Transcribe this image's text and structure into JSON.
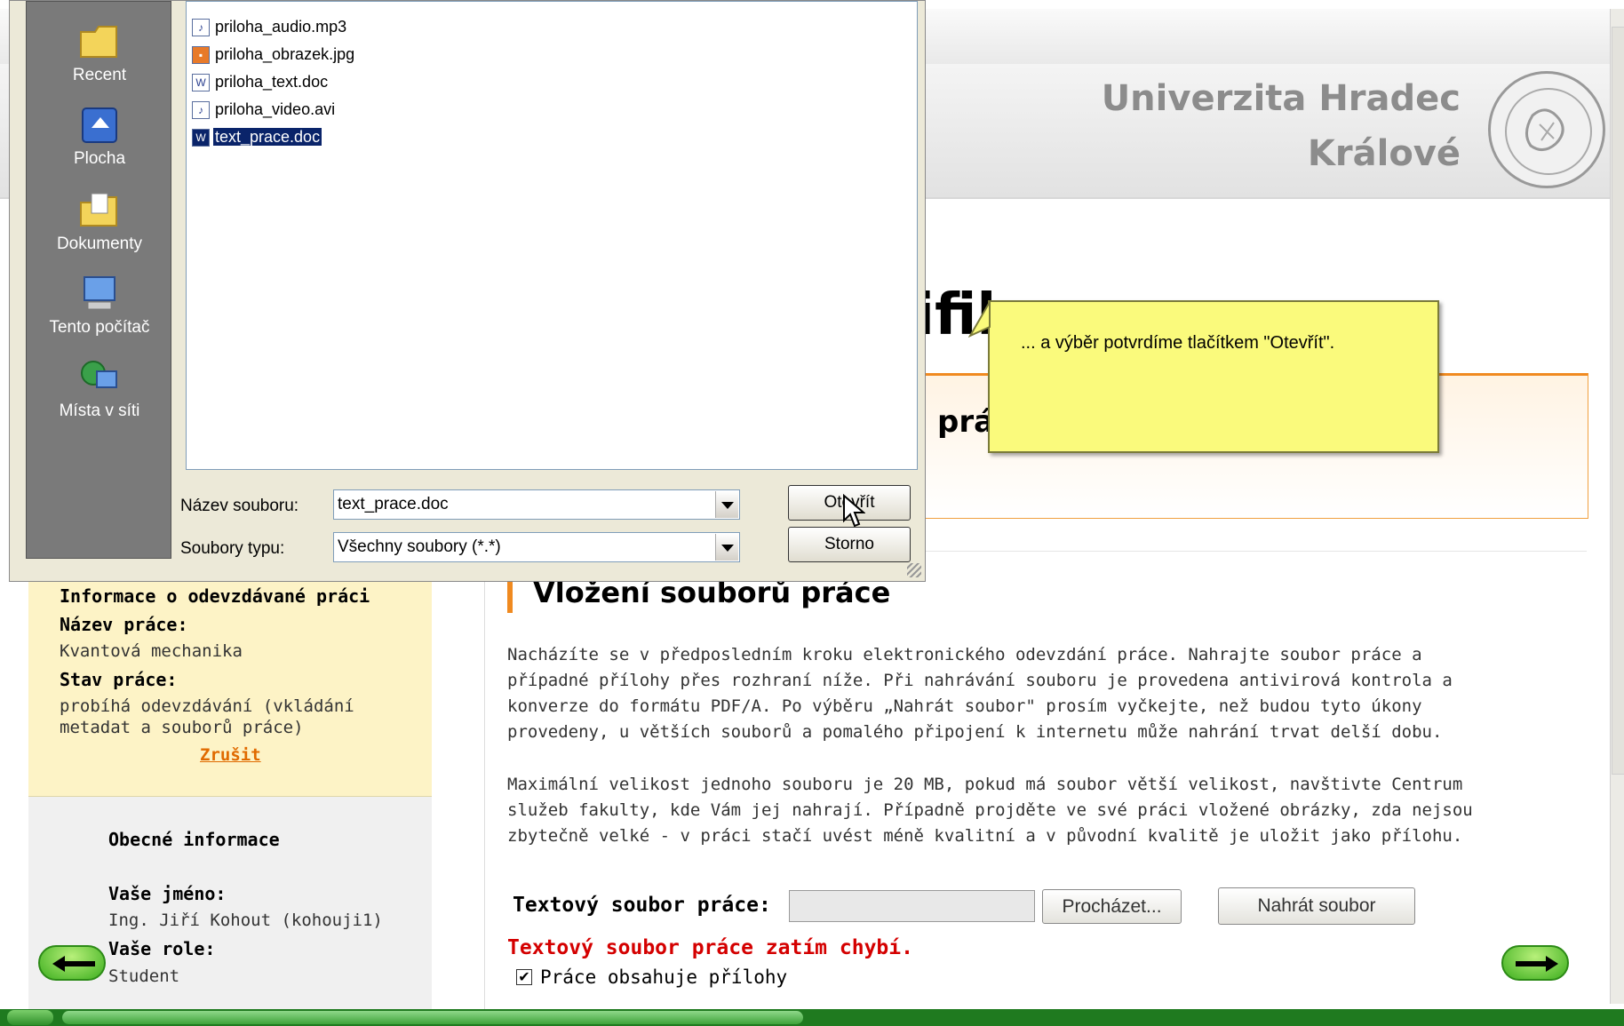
{
  "university": {
    "line1": "Univerzita Hradec",
    "line2": "Králové"
  },
  "page_heading_fragment": "ifik",
  "orange_box_fragment": "prá",
  "sidebar": {
    "info_title": "Informace o odevzdávané práci",
    "work_name_label": "Název práce:",
    "work_name_value": "Kvantová mechanika",
    "work_state_label": "Stav práce:",
    "work_state_value_line1": "probíhá odevzdávání (vkládání",
    "work_state_value_line2": "metadat a souborů práce)",
    "cancel_link": "Zrušit",
    "general_title": "Obecné informace",
    "your_name_label": "Vaše jméno:",
    "your_name_value": "Ing. Jiří Kohout (kohouji1)",
    "your_role_label": "Vaše role:",
    "your_role_value": "Student"
  },
  "content": {
    "section_title": "Vložení souborů práce",
    "para1": [
      "Nacházíte se v předposledním kroku elektronického odevzdání práce. Nahrajte soubor práce a",
      "případné přílohy přes rozhraní níže. Při nahrávání souboru je provedena antivirová kontrola a",
      "konverze do formátu PDF/A. Po výběru „Nahrát soubor\" prosím vyčkejte, než budou tyto úkony",
      "provedeny, u větších souborů a pomalého připojení k internetu může nahrání trvat delší dobu."
    ],
    "para2": [
      "Maximální velikost jednoho souboru je 20 MB, pokud má soubor větší velikost, navštivte Centrum",
      "služeb fakulty, kde Vám jej nahrají. Případně projděte ve své práci vložené obrázky, zda nejsou",
      "zbytečně velké - v práci stačí uvést méně kvalitní a v původní kvalitě je uložit jako přílohu."
    ],
    "file_label": "Textový soubor práce:",
    "file_input_value": "",
    "browse_button": "Procházet...",
    "upload_button": "Nahrát soubor",
    "error_text": "Textový soubor práce zatím chybí.",
    "attachments_checkbox_label": "Práce obsahuje přílohy",
    "attachments_checked": true
  },
  "dialog": {
    "places": [
      {
        "label": "Recent",
        "icon": "folder-icon"
      },
      {
        "label": "Plocha",
        "icon": "desktop-icon"
      },
      {
        "label": "Dokumenty",
        "icon": "documents-folder-icon"
      },
      {
        "label": "Tento počítač",
        "icon": "computer-icon"
      },
      {
        "label": "Místa v síti",
        "icon": "network-icon"
      }
    ],
    "files": [
      {
        "name": "priloha_audio.mp3",
        "icon": "audio-file-icon"
      },
      {
        "name": "priloha_obrazek.jpg",
        "icon": "image-file-icon"
      },
      {
        "name": "priloha_text.doc",
        "icon": "word-file-icon"
      },
      {
        "name": "priloha_video.avi",
        "icon": "video-file-icon"
      },
      {
        "name": "text_prace.doc",
        "icon": "word-file-icon",
        "selected": true
      }
    ],
    "filename_label": "Název souboru:",
    "filename_value": "text_prace.doc",
    "filetype_label": "Soubory typu:",
    "filetype_value": "Všechny soubory (*.*)",
    "open_button": "Otevřít",
    "cancel_button": "Storno"
  },
  "tooltip": {
    "text": "... a výběr potvrdíme tlačítkem \"Otevřít\"."
  },
  "colors": {
    "accent_orange": "#f08a20",
    "error_red": "#d40000",
    "selection_blue": "#0a246a",
    "tooltip_yellow": "#fafa7c",
    "nav_green": "#3cae1e"
  }
}
